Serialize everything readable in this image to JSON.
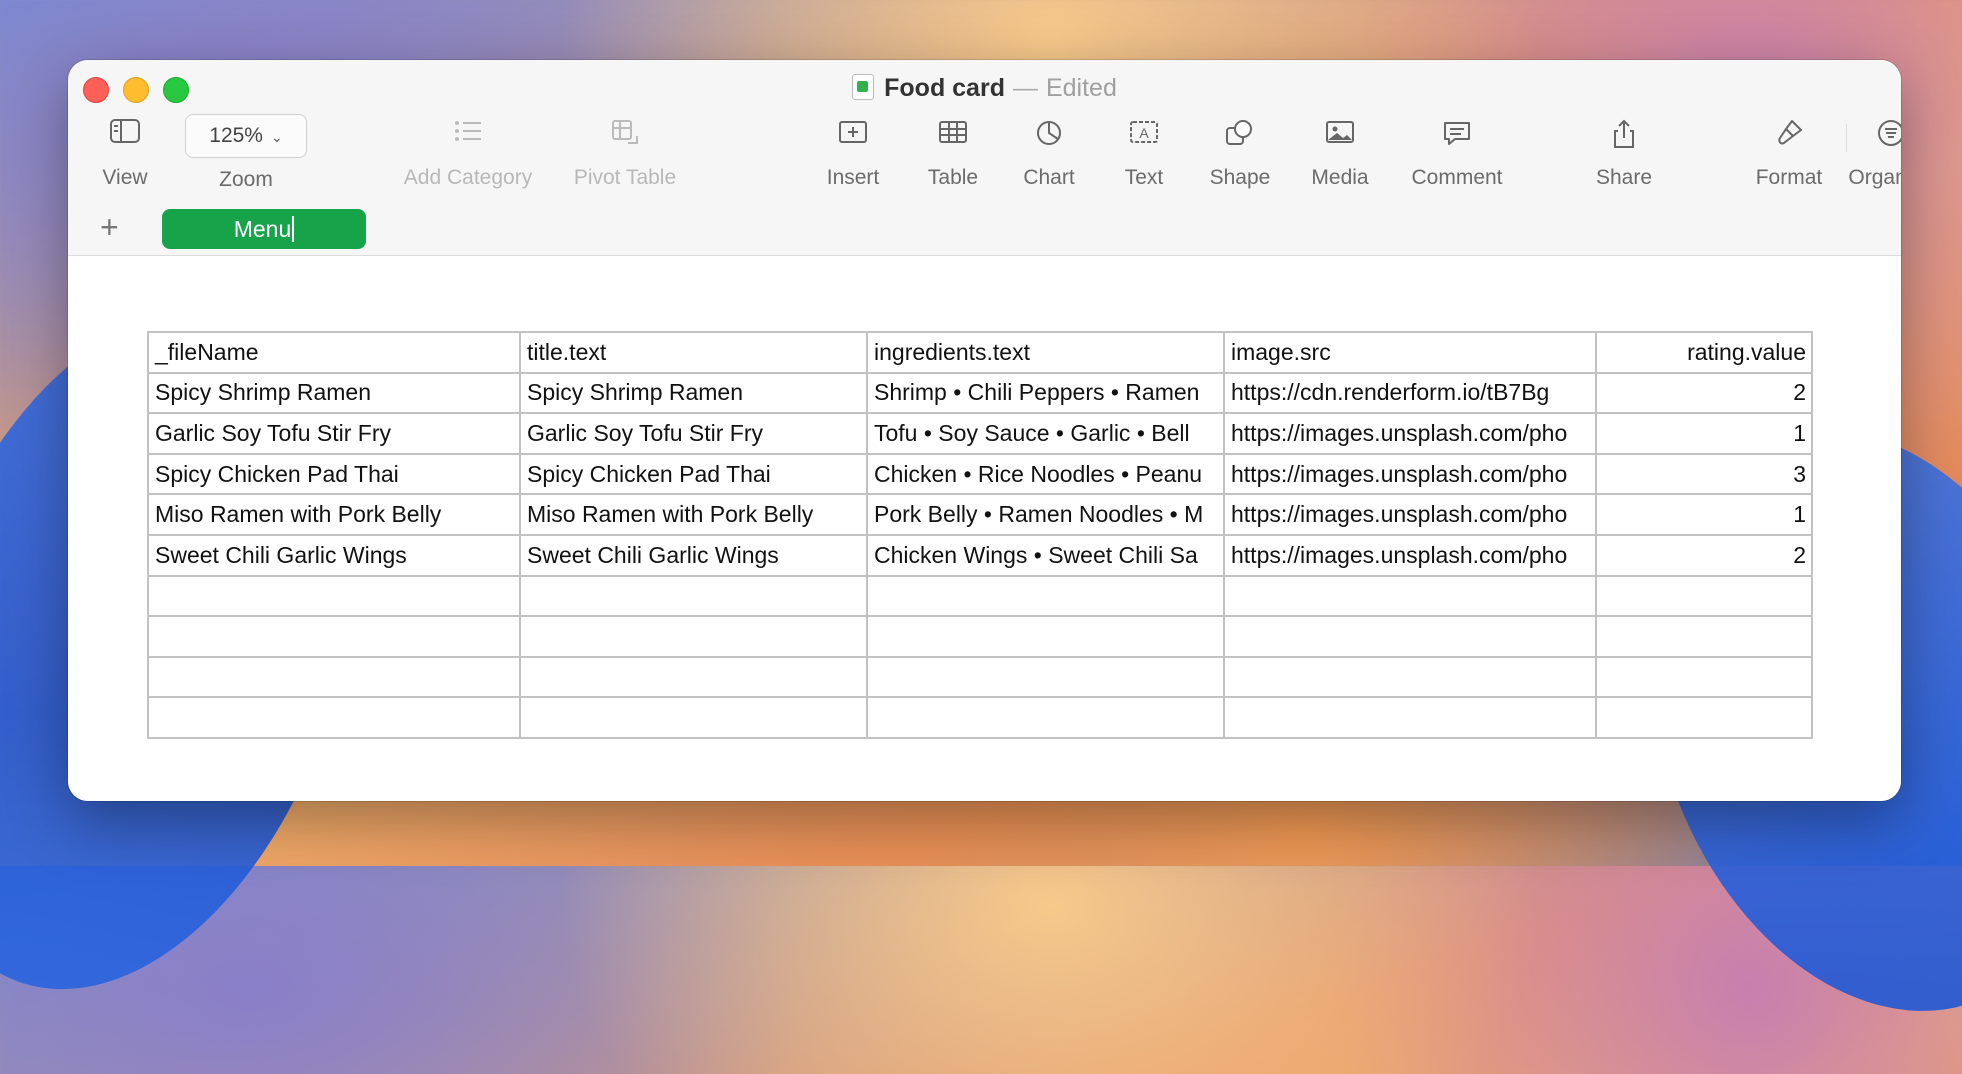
{
  "window": {
    "doc_title": "Food card",
    "status": "Edited"
  },
  "toolbar": {
    "view": "View",
    "zoom_value": "125%",
    "zoom": "Zoom",
    "add_category": "Add Category",
    "pivot_table": "Pivot Table",
    "insert": "Insert",
    "table": "Table",
    "chart": "Chart",
    "text": "Text",
    "shape": "Shape",
    "media": "Media",
    "comment": "Comment",
    "share": "Share",
    "format": "Format",
    "organise": "Organise"
  },
  "sheet": {
    "add_label": "+",
    "active_tab": "Menu"
  },
  "table": {
    "headers": [
      "_fileName",
      "title.text",
      "ingredients.text",
      "image.src",
      "rating.value"
    ],
    "rows": [
      [
        "Spicy Shrimp Ramen",
        "Spicy Shrimp Ramen",
        "Shrimp • Chili Peppers • Ramen",
        "https://cdn.renderform.io/tB7Bg",
        "2"
      ],
      [
        "Garlic Soy Tofu Stir Fry",
        "Garlic Soy Tofu Stir Fry",
        "Tofu • Soy Sauce • Garlic • Bell",
        "https://images.unsplash.com/pho",
        "1"
      ],
      [
        "Spicy Chicken Pad Thai",
        "Spicy Chicken Pad Thai",
        "Chicken • Rice Noodles • Peanu",
        "https://images.unsplash.com/pho",
        "3"
      ],
      [
        "Miso Ramen with Pork Belly",
        "Miso Ramen with Pork Belly",
        "Pork Belly • Ramen Noodles • M",
        "https://images.unsplash.com/pho",
        "1"
      ],
      [
        "Sweet Chili Garlic Wings",
        "Sweet Chili Garlic Wings",
        "Chicken Wings • Sweet Chili Sa",
        "https://images.unsplash.com/pho",
        "2"
      ],
      [
        "",
        "",
        "",
        "",
        ""
      ],
      [
        "",
        "",
        "",
        "",
        ""
      ],
      [
        "",
        "",
        "",
        "",
        ""
      ],
      [
        "",
        "",
        "",
        "",
        ""
      ]
    ]
  }
}
